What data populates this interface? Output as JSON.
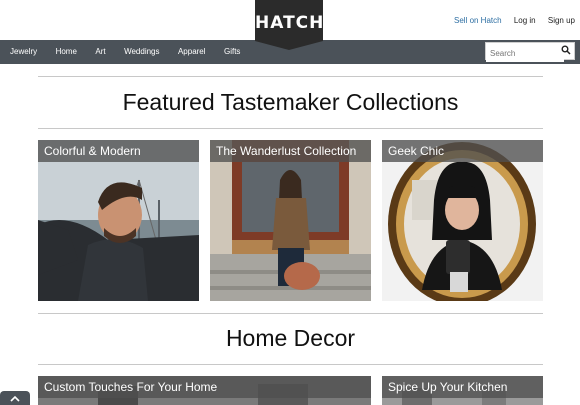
{
  "brand": {
    "name": "HATCH"
  },
  "header": {
    "links": [
      {
        "label": "Sell on Hatch"
      },
      {
        "label": "Log in"
      },
      {
        "label": "Sign up"
      }
    ]
  },
  "nav": {
    "items": [
      "Jewelry",
      "Home",
      "Art",
      "Weddings",
      "Apparel",
      "Gifts"
    ],
    "search_placeholder": "Search"
  },
  "sections": [
    {
      "title": "Featured Tastemaker Collections",
      "cards": [
        {
          "caption": "Colorful & Modern"
        },
        {
          "caption": "The Wanderlust Collection"
        },
        {
          "caption": "Geek Chic"
        }
      ]
    },
    {
      "title": "Home Decor",
      "cards": [
        {
          "caption": "Custom Touches For Your Home"
        },
        {
          "caption": "Spice Up Your Kitchen"
        }
      ]
    }
  ],
  "colors": {
    "nav": "#4b5259",
    "logo": "#2b2b2b",
    "link_accent": "#2e6fa3",
    "caption_bg": "#505050"
  },
  "icons": [
    "search-icon",
    "chevron-up-icon"
  ]
}
